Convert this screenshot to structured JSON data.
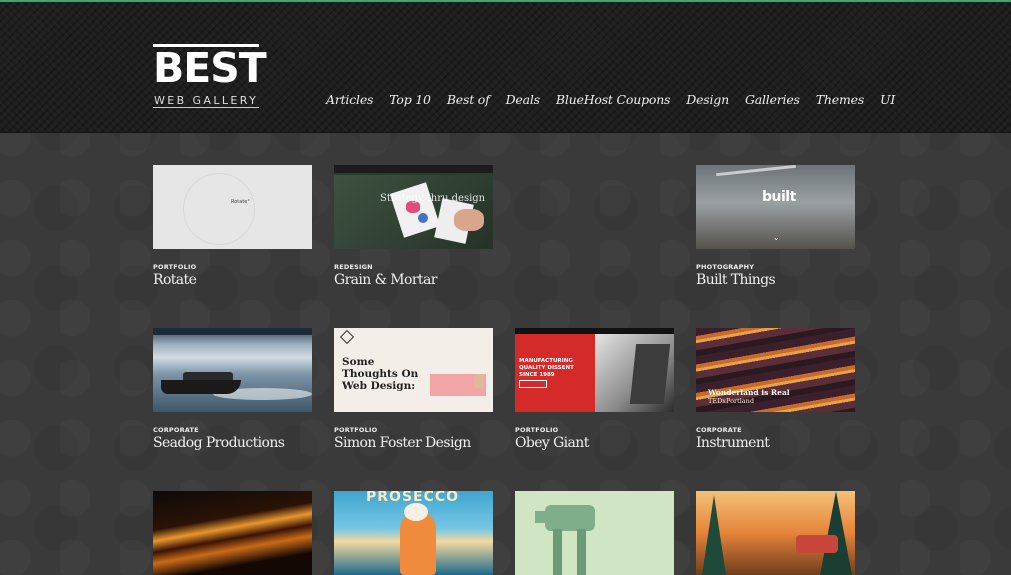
{
  "site": {
    "logo_main": "BEST",
    "logo_sub": "WEB GALLERY"
  },
  "nav": {
    "items": [
      "Articles",
      "Top 10",
      "Best of",
      "Deals",
      "BlueHost Coupons",
      "Design",
      "Galleries",
      "Themes",
      "UI"
    ]
  },
  "colors": {
    "top_line": "#3aa76d",
    "header_bg": "#1e1e1e",
    "page_bg": "#3a3a3a"
  },
  "gallery": [
    {
      "category": "PORTFOLIO",
      "title": "Rotate",
      "thumb_text": "Rotate°"
    },
    {
      "category": "REDESIGN",
      "title": "Grain & Mortar",
      "thumb_text": "Strategy thru design"
    },
    {
      "category": "PHOTOGRAPHY",
      "title": "Built Things",
      "thumb_text": "built"
    },
    {
      "category": "CORPORATE",
      "title": "Seadog Productions"
    },
    {
      "category": "PORTFOLIO",
      "title": "Simon Foster Design",
      "thumb_text": "Some Thoughts On Web Design:"
    },
    {
      "category": "PORTFOLIO",
      "title": "Obey Giant",
      "thumb_text": "MANUFACTURING QUALITY DISSENT SINCE 1989"
    },
    {
      "category": "CORPORATE",
      "title": "Instrument",
      "thumb_text": "Wonderland is Real",
      "thumb_sub": "TEDxPortland"
    },
    {
      "thumb_text": "PROSECCO"
    }
  ]
}
